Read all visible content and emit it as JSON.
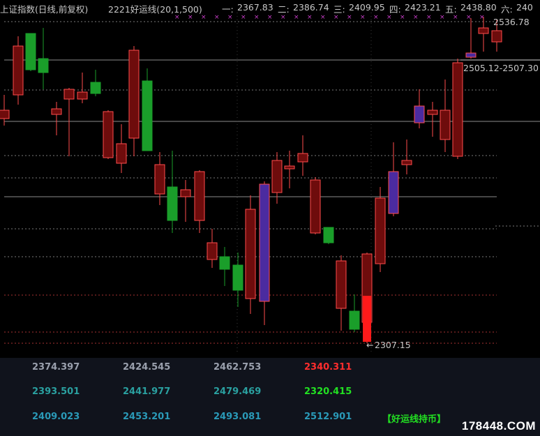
{
  "header": {
    "title": "上证指数(日线,前复权)",
    "indicator": "2221好运线(20,1,500)",
    "levels": [
      {
        "label": "一:",
        "value": "2367.83"
      },
      {
        "label": "二:",
        "value": "2386.74"
      },
      {
        "label": "三:",
        "value": "2409.95"
      },
      {
        "label": "四:",
        "value": "2423.21"
      },
      {
        "label": "五:",
        "value": "2438.80"
      },
      {
        "label": "六:",
        "value": "240"
      }
    ]
  },
  "chart": {
    "high_label": "2536.78",
    "band_label": "2505.12-2507.30",
    "low_label": "2307.15",
    "colors": {
      "up": "#ff4c4c",
      "up_fill": "#6e0c0c",
      "down": "#1a9e2a",
      "special": "#7b3fc4",
      "special_fill": "#4b2ba0",
      "limit": "#ff1a1a",
      "grid": "#8c8c8c",
      "dashed": "#7a7a7a",
      "red_dashed": "#a83232",
      "marker": "#c93ec9"
    }
  },
  "panel": {
    "rows": [
      {
        "values": [
          "2374.397",
          "2424.545",
          "2462.753",
          "2340.311"
        ],
        "colors": [
          "#9aa0ad",
          "#9aa0ad",
          "#9aa0ad",
          "#ff2d2d"
        ]
      },
      {
        "values": [
          "2393.501",
          "2441.977",
          "2479.469",
          "2320.415"
        ],
        "colors": [
          "#2aa0a0",
          "#2aa0a0",
          "#2aa0a0",
          "#22e022"
        ]
      },
      {
        "values": [
          "2409.023",
          "2453.201",
          "2493.081",
          "2512.901"
        ],
        "colors": [
          "#2a9ab8",
          "#2a9ab8",
          "#2a9ab8",
          "#2a9ab8"
        ]
      }
    ],
    "indicator_label": "【好运线持币】",
    "indicator_color": "#22e022"
  },
  "watermark": "178448.COM"
}
